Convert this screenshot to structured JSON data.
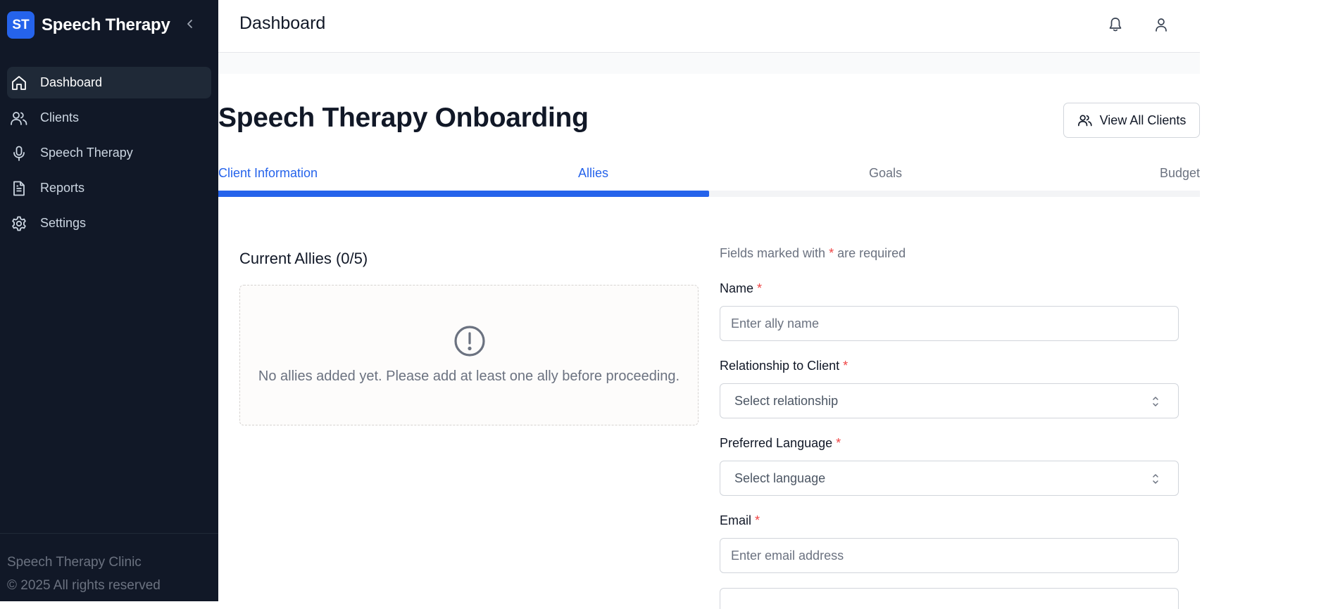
{
  "sidebar": {
    "logo_text": "ST",
    "brand": "Speech Therapy",
    "items": [
      {
        "label": "Dashboard",
        "icon": "home-icon",
        "active": true
      },
      {
        "label": "Clients",
        "icon": "users-icon"
      },
      {
        "label": "Speech Therapy",
        "icon": "microphone-icon"
      },
      {
        "label": "Reports",
        "icon": "document-icon"
      },
      {
        "label": "Settings",
        "icon": "gear-icon"
      }
    ],
    "footer_line1": "Speech Therapy Clinic",
    "footer_line2": "© 2025 All rights reserved"
  },
  "header": {
    "title": "Dashboard"
  },
  "main": {
    "title": "Speech Therapy Onboarding",
    "view_all_label": "View All Clients",
    "steps": [
      {
        "label": "Client Information",
        "state": "done"
      },
      {
        "label": "Allies",
        "state": "current"
      },
      {
        "label": "Goals",
        "state": "todo"
      },
      {
        "label": "Budget",
        "state": "todo"
      }
    ],
    "progress_fraction": 0.5,
    "allies": {
      "heading": "Current Allies (0/5)",
      "empty_message": "No allies added yet. Please add at least one ally before proceeding."
    },
    "form": {
      "required_note_prefix": "Fields marked with ",
      "required_star": "*",
      "required_note_suffix": " are required",
      "name_label": "Name",
      "name_placeholder": "Enter ally name",
      "relationship_label": "Relationship to Client",
      "relationship_value": "Select relationship",
      "language_label": "Preferred Language",
      "language_value": "Select language",
      "email_label": "Email",
      "email_placeholder": "Enter email address"
    }
  },
  "colors": {
    "sidebar_bg": "#111827",
    "accent": "#2563eb",
    "required": "#ef4444"
  }
}
